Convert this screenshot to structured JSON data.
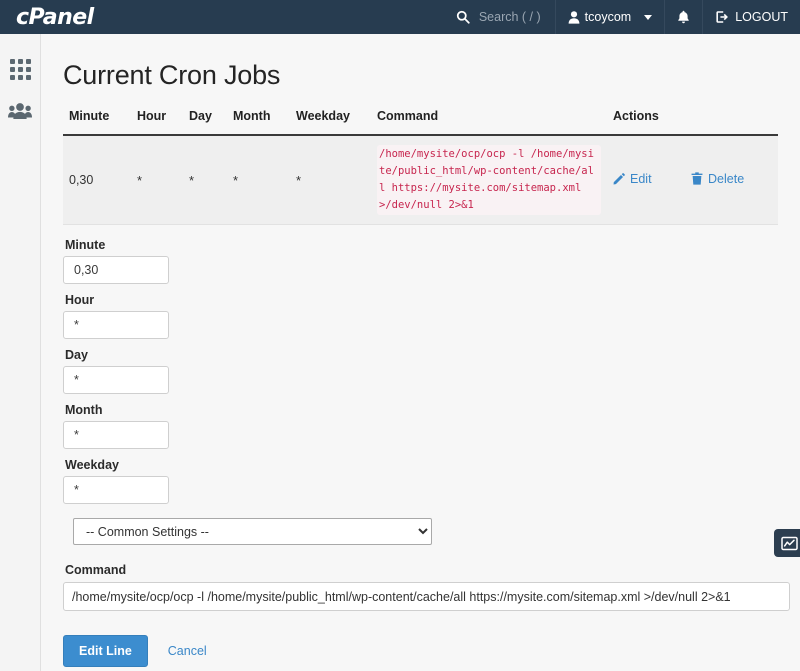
{
  "header": {
    "brand": "cPanel",
    "search_placeholder": "Search ( / )",
    "user_name": "tcoycom",
    "logout_label": "LOGOUT",
    "colors": {
      "bar": "#273c50",
      "text": "#ffffff",
      "placeholder": "#9aa6b2"
    }
  },
  "sidebar": {
    "items": [
      {
        "icon": "grid-icon",
        "name": "apps"
      },
      {
        "icon": "users-icon",
        "name": "user-manager"
      }
    ]
  },
  "page": {
    "title": "Current Cron Jobs"
  },
  "table": {
    "headers": [
      "Minute",
      "Hour",
      "Day",
      "Month",
      "Weekday",
      "Command",
      "Actions"
    ],
    "rows": [
      {
        "minute": "0,30",
        "hour": "*",
        "day": "*",
        "month": "*",
        "weekday": "*",
        "command": "/home/mysite/ocp/ocp -l /home/mysite/public_html/wp-content/cache/all https://mysite.com/sitemap.xml >/dev/null 2>&1",
        "edit_label": "Edit",
        "delete_label": "Delete"
      }
    ],
    "command_color": "#c7254e",
    "command_bg": "#f9f2f4",
    "link_color": "#3a87c8"
  },
  "form": {
    "fields": [
      {
        "label": "Minute",
        "value": "0,30"
      },
      {
        "label": "Hour",
        "value": "*"
      },
      {
        "label": "Day",
        "value": "*"
      },
      {
        "label": "Month",
        "value": "*"
      },
      {
        "label": "Weekday",
        "value": "*"
      }
    ],
    "common_settings": {
      "selected": "-- Common Settings --"
    },
    "command": {
      "label": "Command",
      "value": "/home/mysite/ocp/ocp -l /home/mysite/public_html/wp-content/cache/all https://mysite.com/sitemap.xml >/dev/null 2>&1"
    },
    "submit_label": "Edit Line",
    "cancel_label": "Cancel",
    "primary_color": "#3c8dcf"
  },
  "floating_widget": {
    "icon": "chart-icon"
  }
}
